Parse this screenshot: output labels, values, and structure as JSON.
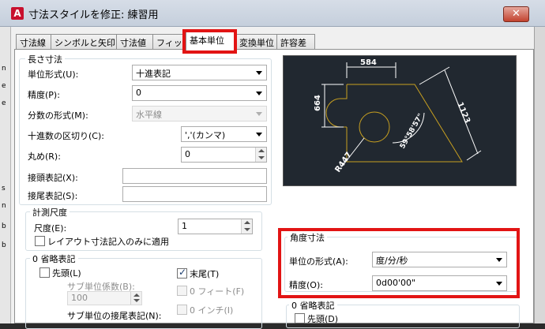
{
  "window": {
    "title": "寸法スタイルを修正: 練習用",
    "close_icon": "close-icon",
    "app_logo": "A"
  },
  "tabs": [
    {
      "label": "寸法線"
    },
    {
      "label": "シンボルと矢印"
    },
    {
      "label": "寸法値"
    },
    {
      "label": "フィット"
    },
    {
      "label": "基本単位",
      "active": true
    },
    {
      "label": "変換単位"
    },
    {
      "label": "許容差"
    }
  ],
  "left_strip": [
    "n",
    "e",
    "e",
    "s",
    "n",
    "b",
    "b"
  ],
  "linear": {
    "group_title": "長さ寸法",
    "unit_format_label": "単位形式(U):",
    "unit_format_value": "十進表記",
    "precision_label": "精度(P):",
    "precision_value": "0",
    "fraction_label": "分数の形式(M):",
    "fraction_value": "水平線",
    "decimal_sep_label": "十進数の区切り(C):",
    "decimal_sep_value": "','(カンマ)",
    "round_label": "丸め(R):",
    "round_value": "0",
    "prefix_label": "接頭表記(X):",
    "suffix_label": "接尾表記(S):"
  },
  "scale": {
    "group_title": "計測尺度",
    "scale_label": "尺度(E):",
    "scale_value": "1",
    "layout_only_label": "レイアウト寸法記入のみに適用"
  },
  "zero_left": {
    "group_title": "0 省略表記",
    "leading_label": "先頭(L)",
    "trailing_label": "末尾(T)",
    "sub_factor_label": "サブ単位係数(B):",
    "sub_factor_value": "100",
    "feet_label": "0 フィート(F)",
    "sub_suffix_label": "サブ単位の接尾表記(N):",
    "inches_label": "0 インチ(I)"
  },
  "preview": {
    "dim_top": "584",
    "dim_left": "664",
    "dim_slant": "1123",
    "angle": "59°58'57\"",
    "radius": "R447"
  },
  "angular": {
    "group_title": "角度寸法",
    "unit_format_label": "単位の形式(A):",
    "unit_format_value": "度/分/秒",
    "precision_label": "精度(O):",
    "precision_value": "0d00'00\""
  },
  "zero_right": {
    "group_title": "0 省略表記",
    "leading_label": "先頭(D)"
  },
  "colors": {
    "highlight": "#e21414",
    "preview_bg": "#212830",
    "geometry": "#c8a020",
    "dims": "#ffffff"
  }
}
